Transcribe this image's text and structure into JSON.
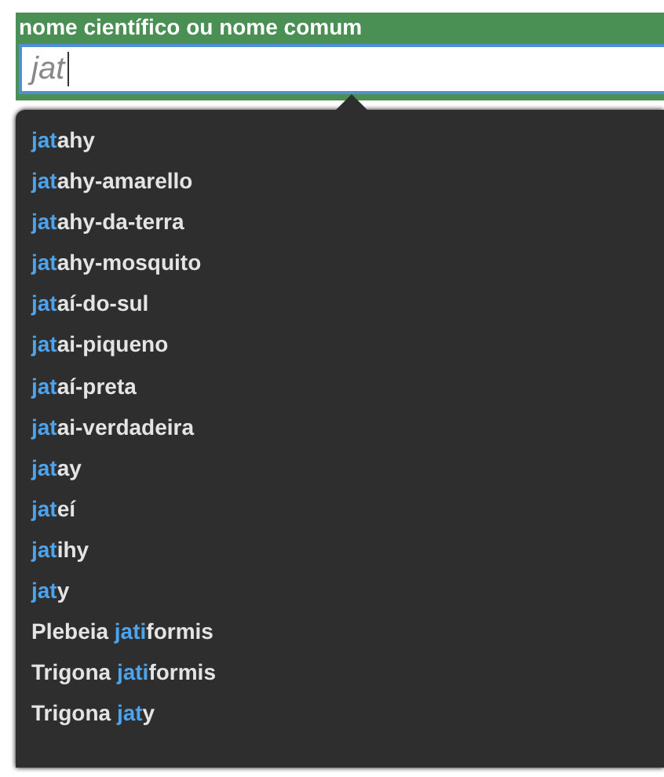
{
  "search": {
    "label": "nome científico ou nome comum",
    "value": "jat"
  },
  "suggestions": [
    {
      "match": "jat",
      "after": "ahy"
    },
    {
      "match": "jat",
      "after": "ahy-amarello"
    },
    {
      "match": "jat",
      "after": "ahy-da-terra"
    },
    {
      "match": "jat",
      "after": "ahy-mosquito"
    },
    {
      "match": "jat",
      "after": "aí-do-sul"
    },
    {
      "match": "jat",
      "after": "ai-piqueno"
    },
    {
      "match": "jat",
      "after": "aí-preta"
    },
    {
      "match": "jat",
      "after": "ai-verdadeira"
    },
    {
      "match": "jat",
      "after": "ay"
    },
    {
      "match": "jat",
      "after": "eí"
    },
    {
      "match": "jat",
      "after": "ihy"
    },
    {
      "match": "jat",
      "after": "y"
    },
    {
      "before": "Plebeia ",
      "match": "jati",
      "after": "formis"
    },
    {
      "before": "Trigona ",
      "match": "jati",
      "after": "formis"
    },
    {
      "before": "Trigona ",
      "match": "jat",
      "after": "y"
    }
  ]
}
